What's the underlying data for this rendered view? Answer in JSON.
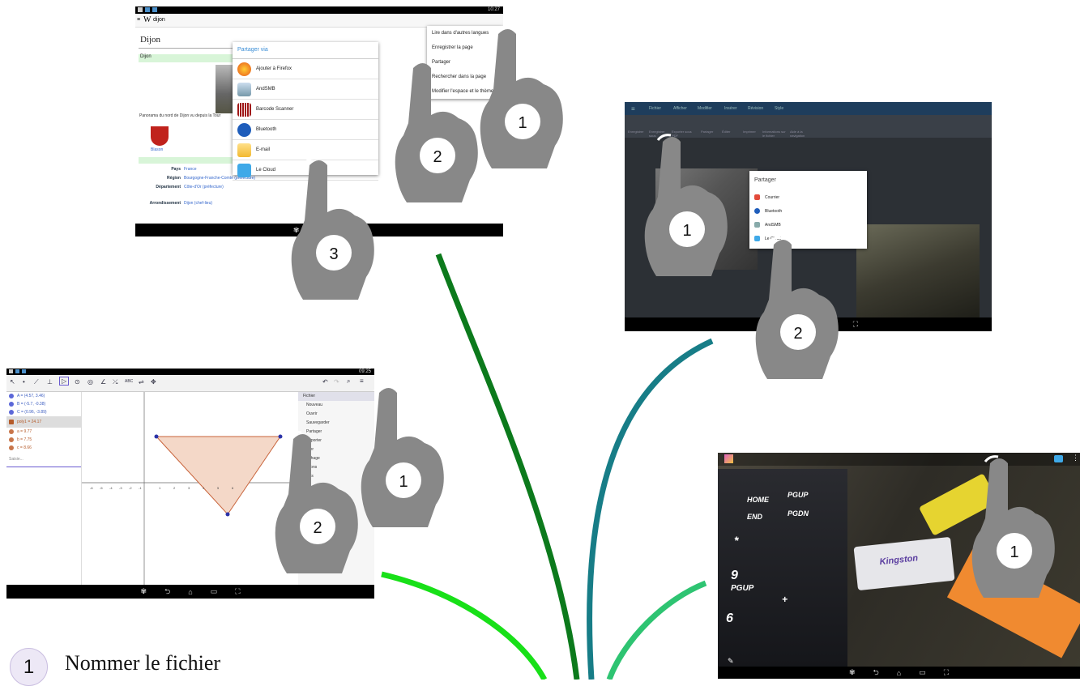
{
  "wiki_shot": {
    "url_bar": "dijon",
    "page_title": "Dijon",
    "green_header": "Dijon",
    "caption": "Panorama du nord de Dijon vu depuis la Tour",
    "coat_label": "Blason",
    "info_rows": [
      {
        "label": "Pays",
        "value": "France"
      },
      {
        "label": "Région",
        "value": "Bourgogne-Franche-Comté (préfecture)"
      },
      {
        "label": "Département",
        "value": "Côte-d'Or (préfecture)"
      },
      {
        "label": "Arrondissement",
        "value": "Dijon (chef-lieu)"
      }
    ],
    "share_dialog": {
      "title": "Partager via",
      "items": [
        "Ajouter à Firefox",
        "AndSMB",
        "Barcode Scanner",
        "Bluetooth",
        "E-mail",
        "Le Cloud"
      ]
    },
    "overflow_menu": [
      "Lire dans d'autres langues",
      "Enregistrer la page",
      "Partager",
      "Rechercher dans la page",
      "Modifier l'espace et le thème"
    ],
    "status_time": "10:27"
  },
  "office_shot": {
    "tabs": [
      "Fichier",
      "Afficher",
      "Modifier",
      "Insérer",
      "Révision",
      "Style"
    ],
    "toolbar": [
      "Enregistrer",
      "Enregistrer sous",
      "Exporter sous PDF",
      "Partager",
      "Éditer",
      "Imprimer",
      "Informations sur le fichier",
      "Aide à la navigation"
    ],
    "share_dialog": {
      "title": "Partager",
      "items": [
        "Courrier",
        "Bluetooth",
        "AndSMB",
        "Le Cloud"
      ]
    }
  },
  "geogebra_shot": {
    "status_time": "09:25",
    "algebra": [
      "A = (4.57, 3.46)",
      "B = (-5.7, -0.38)",
      "C = (0.96, -3.89)",
      "poly1 = 24.17",
      "a = 9.77",
      "b = 7.75",
      "c = 8.66"
    ],
    "input_placeholder": "Saisie...",
    "axis_labels": [
      "-6",
      "-5",
      "-4",
      "-3",
      "-2",
      "-1",
      "1",
      "2",
      "3",
      "4",
      "5",
      "6"
    ],
    "tool_label": "ABC",
    "menu": [
      "Fichier",
      "Nouveau",
      "Ouvrir",
      "Sauvegarder",
      "Partager",
      "Exporter",
      "Éditer",
      "Affichage",
      "Options",
      "Outils"
    ]
  },
  "photo_shot": {
    "keys": [
      "HOME",
      "PGUP",
      "END",
      "PGDN",
      "*",
      "9",
      "PGUP",
      "6",
      "+"
    ],
    "usb_label": "Kingston"
  },
  "hands": {
    "wiki": [
      "1",
      "2",
      "3"
    ],
    "office": [
      "1",
      "2"
    ],
    "geogebra": [
      "1",
      "2"
    ],
    "photo": [
      "1"
    ]
  },
  "legend": {
    "badge": "1",
    "text": "Nommer le fichier"
  },
  "colors": {
    "branch_dark_green": "#0c7a1c",
    "branch_teal": "#177d87",
    "branch_bright_green": "#18e018",
    "branch_mid_green": "#2ec472",
    "hand_gray": "#888888"
  }
}
